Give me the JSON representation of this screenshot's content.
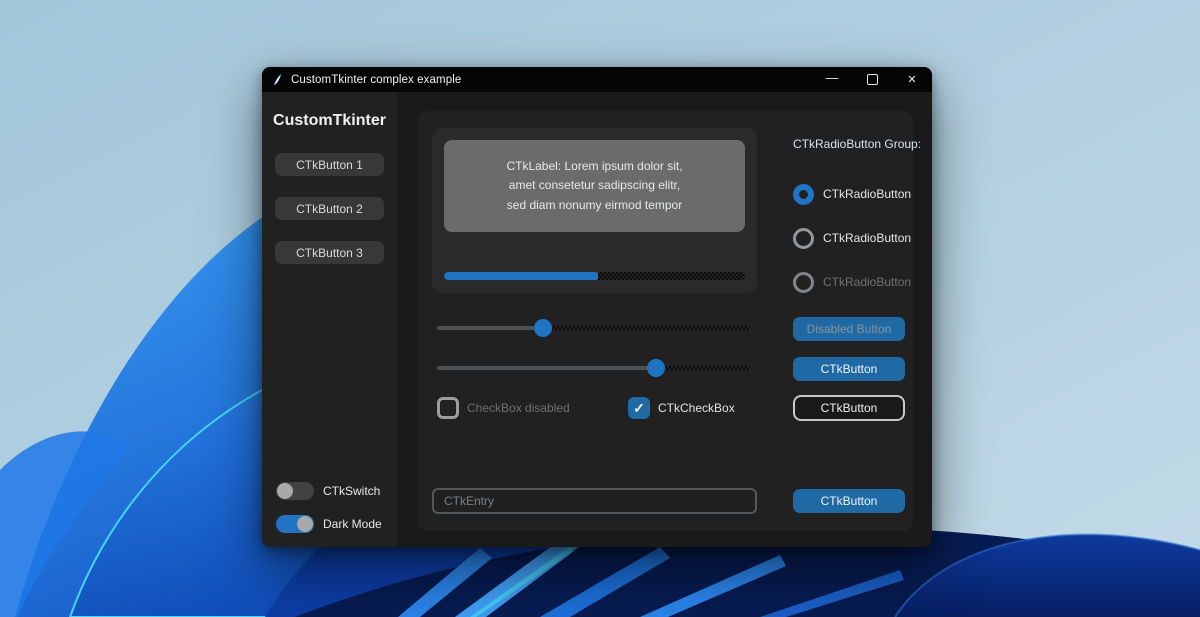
{
  "colors": {
    "accent": "#1f6aa5",
    "accent_bright": "#2173c4",
    "window_bg": "#1a1a1a",
    "sidebar_bg": "#212121",
    "panel_bg": "#212121",
    "inner_frame_bg": "#2a2a2a",
    "label_bg": "#6b6b6b",
    "titlebar_bg": "#050505"
  },
  "titlebar": {
    "title": "CustomTkinter complex example",
    "minimize_glyph": "—",
    "close_glyph": "✕"
  },
  "icons": {
    "check": "✓"
  },
  "sidebar": {
    "title": "CustomTkinter",
    "buttons": [
      "CTkButton 1",
      "CTkButton 2",
      "CTkButton 3"
    ],
    "switches": [
      {
        "label": "CTkSwitch",
        "on": false
      },
      {
        "label": "Dark Mode",
        "on": true
      }
    ]
  },
  "main": {
    "info_label": "CTkLabel: Lorem ipsum dolor sit,\namet consetetur sadipscing elitr,\nsed diam nonumy eirmod tempor",
    "progress_percent": 51,
    "sliders": [
      {
        "value": 34
      },
      {
        "value": 70
      }
    ],
    "checkboxes": [
      {
        "label": "CheckBox disabled",
        "checked": false,
        "disabled": true
      },
      {
        "label": "CTkCheckBox",
        "checked": true,
        "disabled": false
      }
    ],
    "entry_placeholder": "CTkEntry"
  },
  "right_column": {
    "group_label": "CTkRadioButton Group:",
    "radios": [
      {
        "label": "CTkRadioButton",
        "selected": true,
        "disabled": false
      },
      {
        "label": "CTkRadioButton",
        "selected": false,
        "disabled": false
      },
      {
        "label": "CTkRadioButton",
        "selected": false,
        "disabled": true
      }
    ],
    "buttons": [
      {
        "label": "Disabled Button",
        "style": "disabled"
      },
      {
        "label": "CTkButton",
        "style": "primary"
      },
      {
        "label": "CTkButton",
        "style": "outline"
      },
      {
        "label": "CTkButton",
        "style": "primary"
      }
    ]
  }
}
